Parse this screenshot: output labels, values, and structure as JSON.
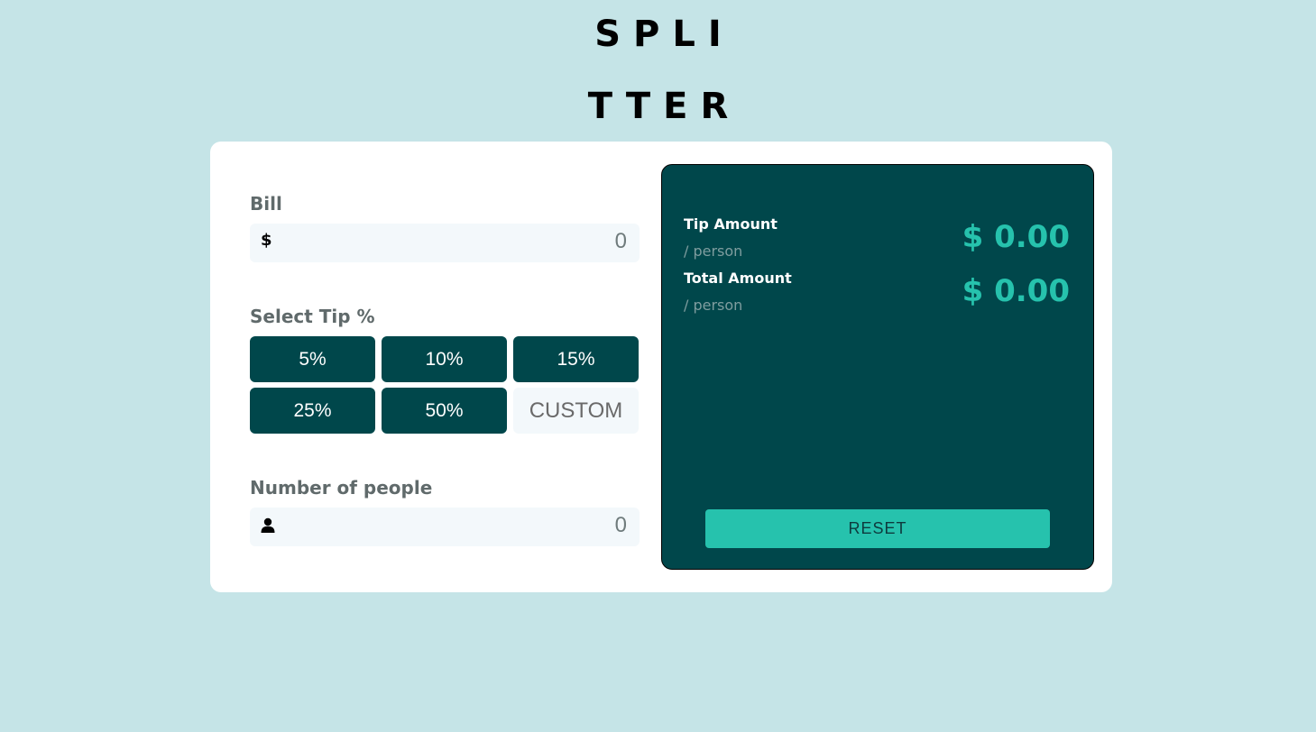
{
  "logo": {
    "line1": "SPLI",
    "line2": "TTER"
  },
  "bill": {
    "label": "Bill",
    "icon": "dollar-icon",
    "icon_glyph": "$",
    "value": "0"
  },
  "tip": {
    "label": "Select Tip %",
    "options": [
      "5%",
      "10%",
      "15%",
      "25%",
      "50%"
    ],
    "custom_label": "CUSTOM"
  },
  "people": {
    "label": "Number of people",
    "icon": "person-icon",
    "value": "0"
  },
  "results": {
    "tip_label": "Tip Amount",
    "tip_sub": "/ person",
    "tip_value": "$ 0.00",
    "total_label": "Total Amount",
    "total_sub": "/ person",
    "total_value": "$ 0.00",
    "reset_label": "RESET"
  },
  "colors": {
    "background": "#c5e4e7",
    "panel": "#00474b",
    "accent": "#26c2ad",
    "input_bg": "#f3f8fb"
  }
}
